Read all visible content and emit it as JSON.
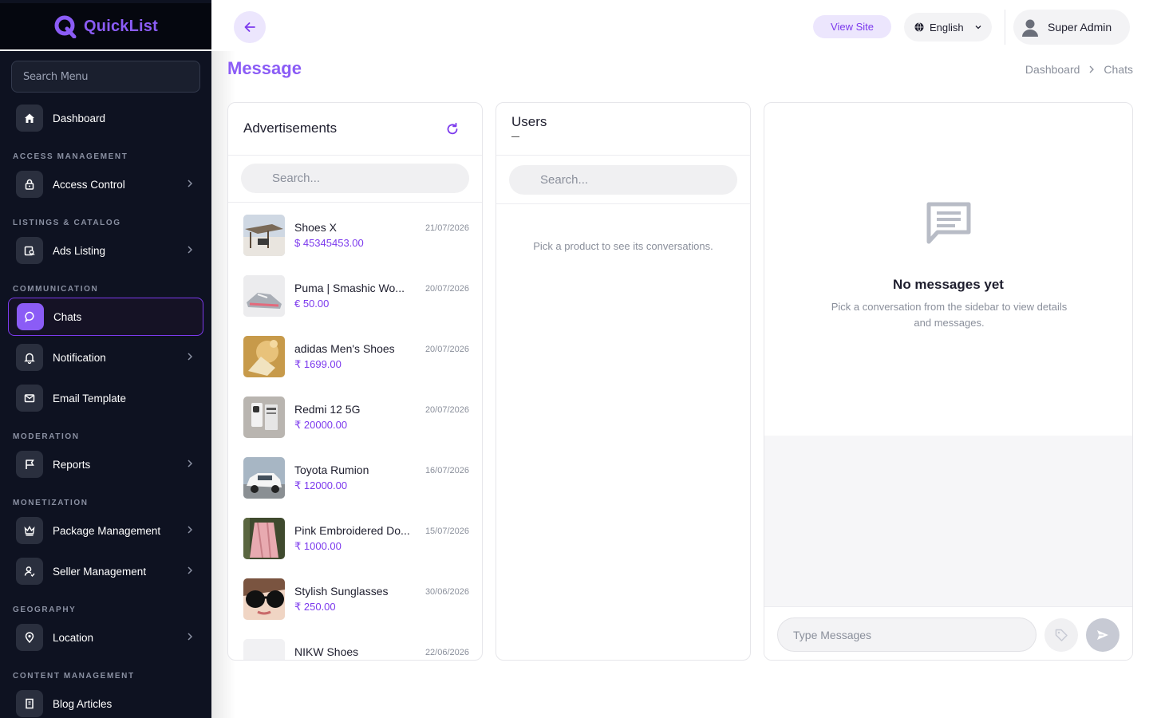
{
  "brand": {
    "name": "QuickList",
    "accent": "#8b5cf6",
    "sidebar_bg": "#0e1221"
  },
  "sidebar": {
    "search_placeholder": "Search Menu",
    "sections": {
      "access": "ACCESS MANAGEMENT",
      "listings": "LISTINGS & CATALOG",
      "communication": "COMMUNICATION",
      "moderation": "MODERATION",
      "monetization": "MONETIZATION",
      "geography": "GEOGRAPHY",
      "content": "CONTENT MANAGEMENT"
    },
    "items": [
      {
        "label": "Dashboard",
        "icon": "home-icon"
      },
      {
        "label": "Access Control",
        "icon": "lock-icon",
        "has_submenu": true
      },
      {
        "label": "Ads Listing",
        "icon": "ads-listing-icon",
        "has_submenu": true
      },
      {
        "label": "Chats",
        "icon": "chat-bubble-icon",
        "active": true
      },
      {
        "label": "Notification",
        "icon": "bell-icon",
        "has_submenu": true
      },
      {
        "label": "Email Template",
        "icon": "mail-icon"
      },
      {
        "label": "Reports",
        "icon": "flag-icon",
        "has_submenu": true
      },
      {
        "label": "Package Management",
        "icon": "crown-icon",
        "has_submenu": true
      },
      {
        "label": "Seller Management",
        "icon": "user-check-icon",
        "has_submenu": true
      },
      {
        "label": "Location",
        "icon": "map-pin-icon",
        "has_submenu": true
      },
      {
        "label": "Blog Articles",
        "icon": "blog-icon"
      }
    ]
  },
  "header": {
    "view_site": "View Site",
    "language": "English",
    "user_name": "Super Admin"
  },
  "page": {
    "title": "Message",
    "breadcrumb": [
      "Dashboard",
      "Chats"
    ]
  },
  "ads_panel": {
    "title": "Advertisements",
    "search_placeholder": "Search...",
    "items": [
      {
        "name": "Shoes X",
        "price": "$ 45345453.00",
        "date": "21/07/2026"
      },
      {
        "name": "Puma | Smashic Wo...",
        "price": "€ 50.00",
        "date": "20/07/2026"
      },
      {
        "name": "adidas Men's Shoes",
        "price": "₹ 1699.00",
        "date": "20/07/2026"
      },
      {
        "name": "Redmi 12 5G",
        "price": "₹ 20000.00",
        "date": "20/07/2026"
      },
      {
        "name": "Toyota Rumion",
        "price": "₹ 12000.00",
        "date": "16/07/2026"
      },
      {
        "name": "Pink Embroidered Do...",
        "price": "₹ 1000.00",
        "date": "15/07/2026"
      },
      {
        "name": "Stylish Sunglasses",
        "price": "₹ 250.00",
        "date": "30/06/2026"
      },
      {
        "name": "NIKW Shoes",
        "price": "",
        "date": "22/06/2026"
      }
    ]
  },
  "users_panel": {
    "title": "Users",
    "search_placeholder": "Search...",
    "empty_text": "Pick a product to see its conversations."
  },
  "chat_panel": {
    "empty_title": "No messages yet",
    "empty_subtitle": "Pick a conversation from the sidebar to view details and messages.",
    "input_placeholder": "Type Messages"
  }
}
